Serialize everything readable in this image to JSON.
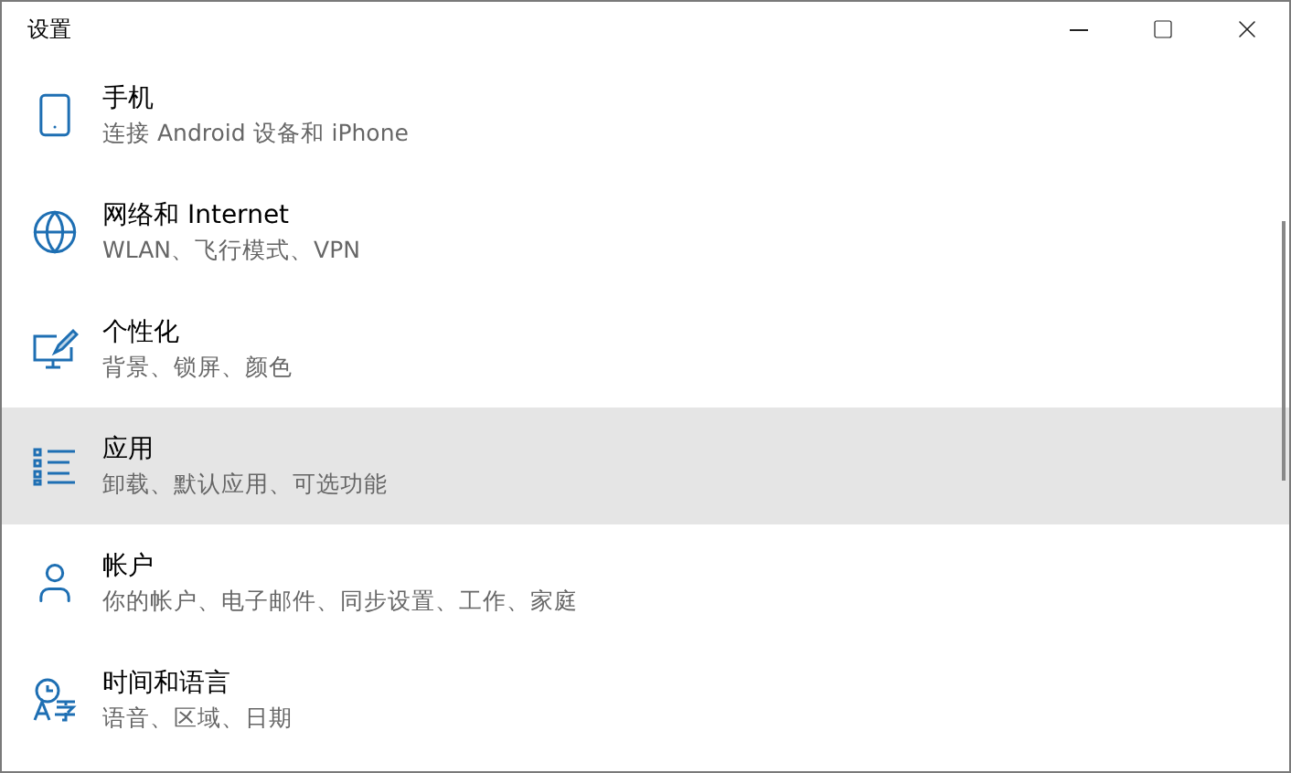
{
  "window": {
    "title": "设置"
  },
  "items": [
    {
      "kind": "phone",
      "title": "手机",
      "subtitle": "连接 Android 设备和 iPhone",
      "highlighted": false
    },
    {
      "kind": "network",
      "title": "网络和 Internet",
      "subtitle": "WLAN、飞行模式、VPN",
      "highlighted": false
    },
    {
      "kind": "personalization",
      "title": "个性化",
      "subtitle": "背景、锁屏、颜色",
      "highlighted": false
    },
    {
      "kind": "apps",
      "title": "应用",
      "subtitle": "卸载、默认应用、可选功能",
      "highlighted": true
    },
    {
      "kind": "accounts",
      "title": "帐户",
      "subtitle": "你的帐户、电子邮件、同步设置、工作、家庭",
      "highlighted": false
    },
    {
      "kind": "time",
      "title": "时间和语言",
      "subtitle": "语音、区域、日期",
      "highlighted": false
    }
  ]
}
